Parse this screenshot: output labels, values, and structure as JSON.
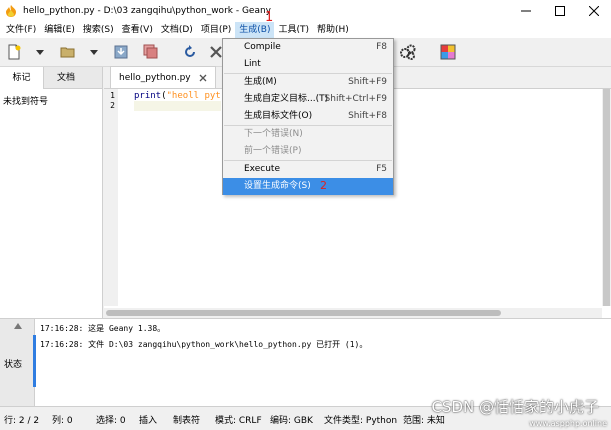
{
  "window": {
    "title": "hello_python.py - D:\\03 zangqihu\\python_work - Geany"
  },
  "menubar": {
    "items": [
      {
        "label": "文件(F)"
      },
      {
        "label": "编辑(E)"
      },
      {
        "label": "搜索(S)"
      },
      {
        "label": "查看(V)"
      },
      {
        "label": "文档(D)"
      },
      {
        "label": "项目(P)"
      },
      {
        "label": "生成(B)"
      },
      {
        "label": "工具(T)"
      },
      {
        "label": "帮助(H)"
      }
    ],
    "annotation_1": "1"
  },
  "sidebar": {
    "tabs": [
      {
        "label": "标记"
      },
      {
        "label": "文档"
      }
    ],
    "empty_text": "未找到符号"
  },
  "editor": {
    "tab_label": "hello_python.py",
    "line_numbers": [
      "1",
      "2"
    ],
    "code_keyword": "print",
    "code_paren": "(",
    "code_string": "\"heoll pyt"
  },
  "build_menu": {
    "items": [
      {
        "label": "Compile",
        "shortcut": "F8"
      },
      {
        "label": "Lint",
        "shortcut": ""
      },
      {
        "label": "生成(M)",
        "shortcut": "Shift+F9"
      },
      {
        "label": "生成自定义目标...(T)",
        "shortcut": "Shift+Ctrl+F9"
      },
      {
        "label": "生成目标文件(O)",
        "shortcut": "Shift+F8"
      },
      {
        "label": "下一个错误(N)",
        "shortcut": ""
      },
      {
        "label": "前一个错误(P)",
        "shortcut": ""
      },
      {
        "label": "Execute",
        "shortcut": "F5"
      },
      {
        "label": "设置生成命令(S)",
        "shortcut": ""
      }
    ],
    "annotation_2": "2"
  },
  "messages": {
    "tab_label": "状态",
    "lines": [
      "17:16:28: 这是 Geany 1.38。",
      "17:16:28: 文件 D:\\03 zangqihu\\python_work\\hello_python.py 已打开 (1)。"
    ]
  },
  "statusbar": {
    "line": "行: 2 / 2",
    "col": "列: 0",
    "sel": "选择: 0",
    "mode": "插入",
    "tab": "制表符",
    "mode2": "模式: CRLF",
    "encoding": "编码: GBK",
    "filetype": "文件类型: Python",
    "scope": "范围: 未知"
  },
  "watermark": {
    "text": "CSDN @恬恬家的小虎子",
    "url": "www.aspphp.online"
  },
  "colors": {
    "menu_highlight": "#3c8ee6",
    "active_menu": "#cce4f7",
    "annotation": "#e02020",
    "message_accent": "#2f7de1"
  }
}
